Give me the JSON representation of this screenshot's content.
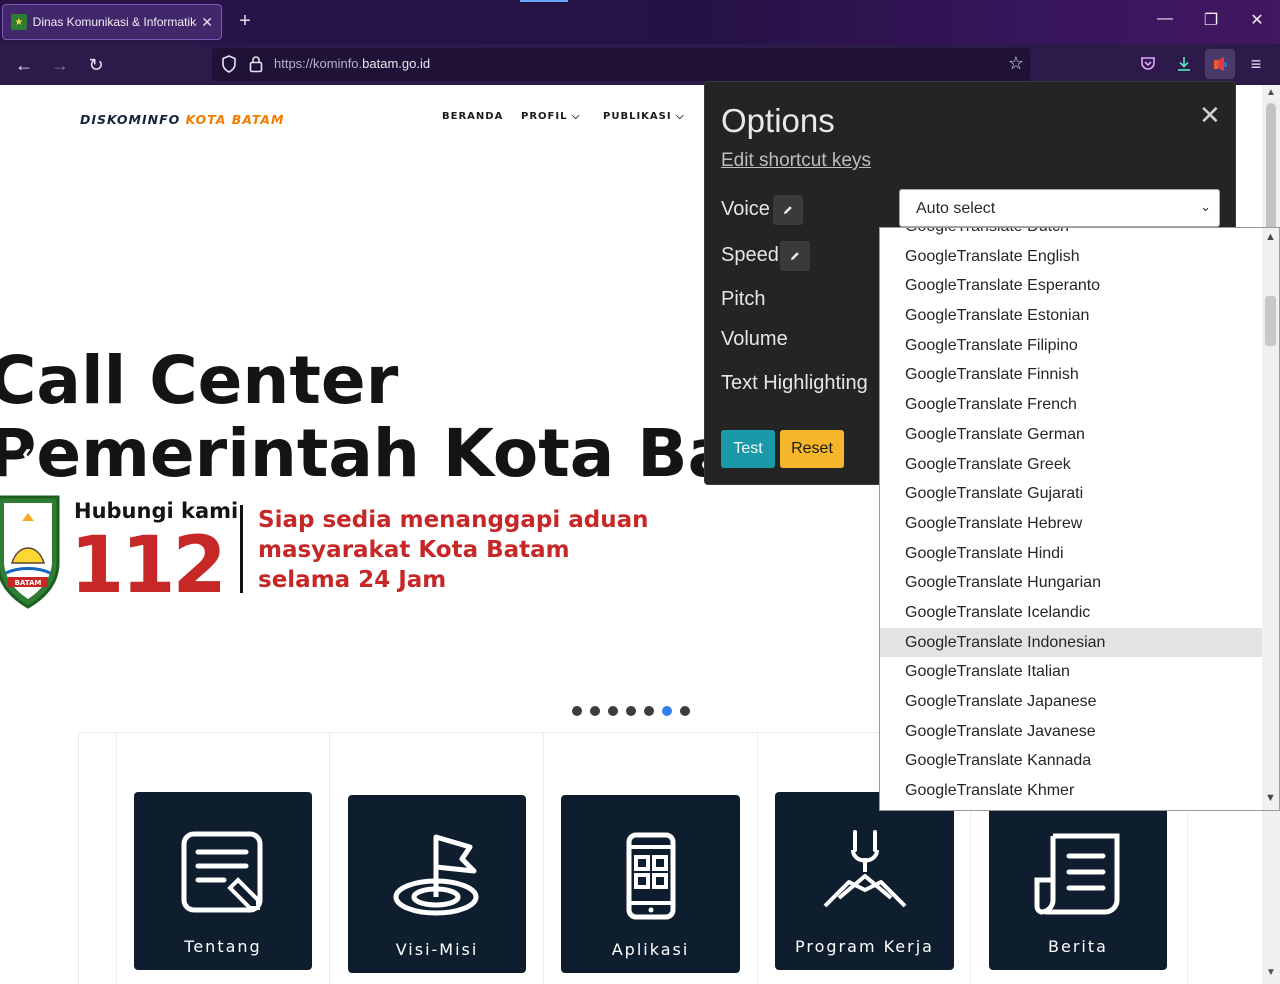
{
  "browser": {
    "tab_title": "Dinas Komunikasi & Informatika",
    "tab_close": "✕",
    "new_tab": "+",
    "url_prefix": "https://kominfo.",
    "url_domain": "batam.go.id",
    "window_controls": [
      "—",
      "❐",
      "✕"
    ]
  },
  "site": {
    "logo_main": "DISKOMINFO ",
    "logo_accent": "KOTA BATAM",
    "menu": [
      "BERANDA",
      "PROFIL ⌵",
      "PUBLIKASI ⌵"
    ]
  },
  "hero": {
    "line1": "Call Center",
    "line2": "Pemerintah Kota Batam",
    "prev_arrow": "‹",
    "contact_label": "Hubungi kami",
    "number": "112",
    "message": [
      "Siap sedia menanggapi aduan",
      "masyarakat Kota Batam",
      "selama 24 Jam"
    ],
    "emblem_text": "BATAM",
    "slide_count": 7,
    "active_slide": 6
  },
  "cards": [
    {
      "label": "Tentang",
      "icon": "document-edit-icon"
    },
    {
      "label": "Visi-Misi",
      "icon": "flag-target-icon"
    },
    {
      "label": "Aplikasi",
      "icon": "phone-apps-icon"
    },
    {
      "label": "Program Kerja",
      "icon": "handshake-team-icon"
    },
    {
      "label": "Berita",
      "icon": "newspaper-icon"
    }
  ],
  "options": {
    "title": "Options",
    "close": "✕",
    "edit_shortcuts": "Edit shortcut keys",
    "labels": {
      "voice": "Voice",
      "speed": "Speed",
      "pitch": "Pitch",
      "volume": "Volume",
      "highlighting": "Text Highlighting"
    },
    "test_button": "Test",
    "reset_button": "Reset",
    "voice_select_value": "Auto select",
    "voice_options": [
      "GoogleTranslate Dutch",
      "GoogleTranslate English",
      "GoogleTranslate Esperanto",
      "GoogleTranslate Estonian",
      "GoogleTranslate Filipino",
      "GoogleTranslate Finnish",
      "GoogleTranslate French",
      "GoogleTranslate German",
      "GoogleTranslate Greek",
      "GoogleTranslate Gujarati",
      "GoogleTranslate Hebrew",
      "GoogleTranslate Hindi",
      "GoogleTranslate Hungarian",
      "GoogleTranslate Icelandic",
      "GoogleTranslate Indonesian",
      "GoogleTranslate Italian",
      "GoogleTranslate Japanese",
      "GoogleTranslate Javanese",
      "GoogleTranslate Kannada",
      "GoogleTranslate Khmer"
    ],
    "highlighted_option": "GoogleTranslate Indonesian"
  },
  "colors": {
    "accent_orange": "#f57c00",
    "hero_red": "#c62828",
    "card_bg": "#0f1e2e",
    "active_dot": "#2f80ed",
    "test_button": "#1a9aa8",
    "reset_button": "#f6b62b"
  }
}
